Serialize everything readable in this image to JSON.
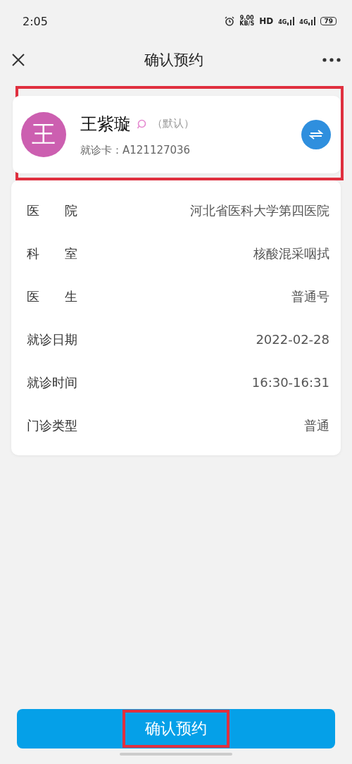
{
  "status_bar": {
    "time": "2:05",
    "speed": "9.00",
    "speed_unit": "KB/S",
    "hd": "HD",
    "network_1": "4G",
    "network_2": "4G",
    "battery": "79"
  },
  "nav": {
    "title": "确认预约"
  },
  "patient": {
    "avatar": "王",
    "name": "王紫璇",
    "tag": "（默认）",
    "card": "就诊卡：A121127036",
    "highlighted": true
  },
  "details": [
    {
      "label": "医　　院",
      "value": "河北省医科大学第四医院"
    },
    {
      "label": "科　　室",
      "value": "核酸混采咽拭"
    },
    {
      "label": "医　　生",
      "value": "普通号"
    },
    {
      "label": "就诊日期",
      "value": "2022-02-28"
    },
    {
      "label": "就诊时间",
      "value": "16:30-16:31"
    },
    {
      "label": "门诊类型",
      "value": "普通"
    }
  ],
  "confirm_button": {
    "label": "确认预约",
    "highlighted": true
  }
}
